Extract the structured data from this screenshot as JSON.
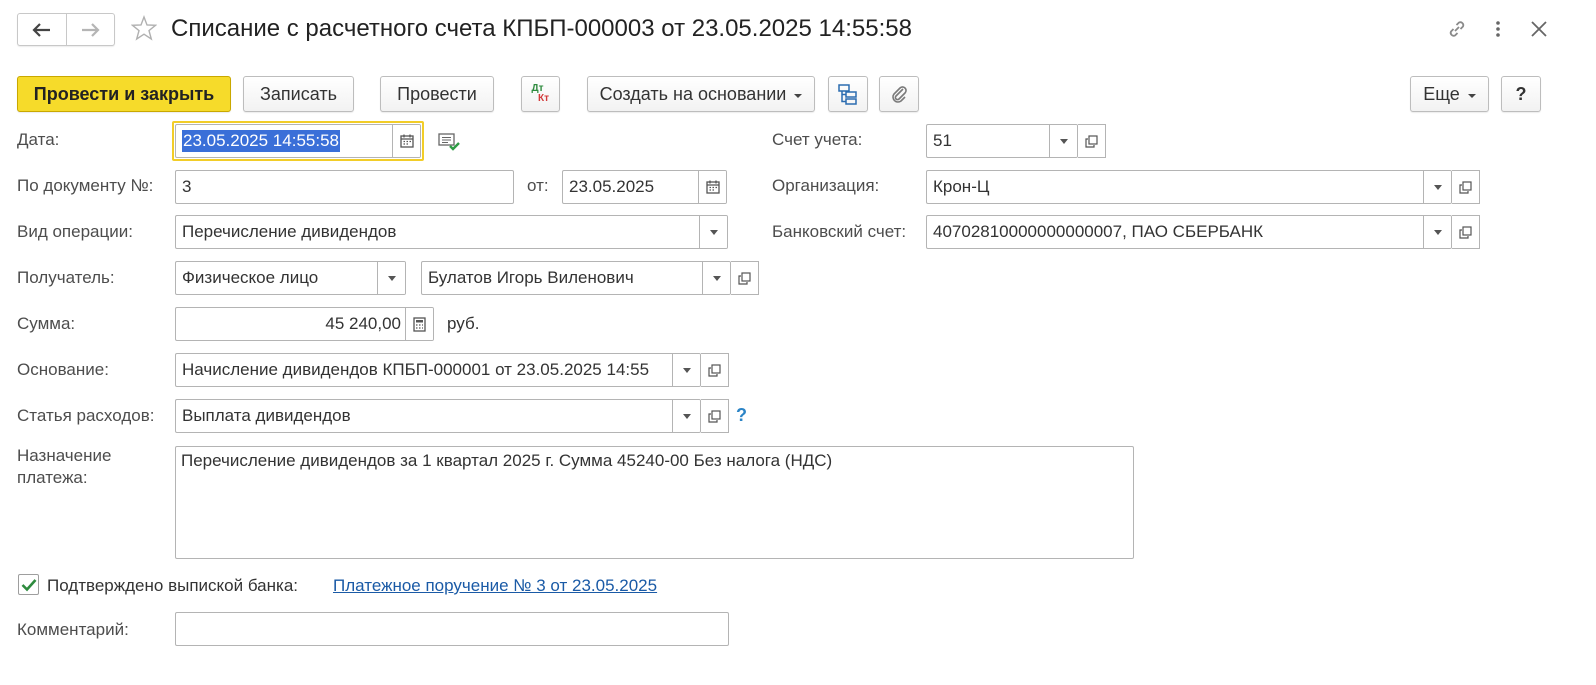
{
  "window": {
    "title": "Списание с расчетного счета КПБП-000003 от 23.05.2025 14:55:58"
  },
  "toolbar": {
    "post_and_close": "Провести и закрыть",
    "save": "Записать",
    "post": "Провести",
    "dt": "Дт",
    "kt": "Кт",
    "create_based_on": "Создать на основании",
    "more": "Еще",
    "help": "?"
  },
  "form": {
    "date": {
      "label": "Дата:",
      "value": "23.05.2025 14:55:58"
    },
    "doc_number": {
      "label": "По документу №:",
      "value": "3"
    },
    "doc_date": {
      "label": "от:",
      "value": "23.05.2025"
    },
    "operation": {
      "label": "Вид операции:",
      "value": "Перечисление дивидендов"
    },
    "recipient": {
      "label": "Получатель:",
      "type_value": "Физическое лицо",
      "value": "Булатов Игорь Виленович"
    },
    "amount": {
      "label": "Сумма:",
      "value": "45 240,00",
      "currency": "руб."
    },
    "basis": {
      "label": "Основание:",
      "value": "Начисление дивидендов КПБП-000001 от 23.05.2025 14:55"
    },
    "expense_item": {
      "label": "Статья расходов:",
      "value": "Выплата дивидендов",
      "help": "?"
    },
    "purpose": {
      "label_line1": "Назначение",
      "label_line2": "платежа:",
      "value": "Перечисление дивидендов за 1 квартал 2025 г. Сумма 45240-00 Без налога (НДС)"
    },
    "account": {
      "label": "Счет учета:",
      "value": "51"
    },
    "organization": {
      "label": "Организация:",
      "value": "Крон-Ц"
    },
    "bank_account": {
      "label": "Банковский счет:",
      "value": "40702810000000000007, ПАО СБЕРБАНК"
    },
    "confirmed": {
      "label": "Подтверждено выпиской банка:",
      "checked": true,
      "link": "Платежное поручение № 3 от 23.05.2025"
    },
    "comment": {
      "label": "Комментарий:",
      "value": ""
    }
  },
  "colors": {
    "primary_button": "#f6db2a",
    "focus_border": "#f2cd28",
    "selection": "#3a6fd8",
    "link": "#1a5aa6",
    "check": "#2e8b3e"
  }
}
